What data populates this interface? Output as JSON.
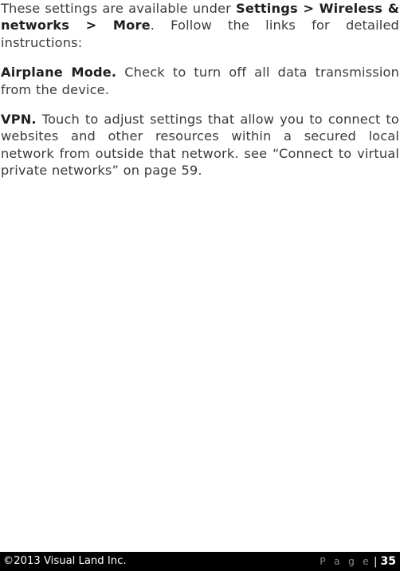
{
  "document": {
    "type": "user-manual-page",
    "background_color": "#ffffff",
    "text_color": "#3b3b3b",
    "bold_text_color": "#1f1f1f",
    "paragraphs": [
      {
        "id": "intro",
        "lead_bold": "",
        "segments": [
          {
            "text": "These settings are available under ",
            "bold": false
          },
          {
            "text": "Settings > Wireless & networks > More",
            "bold": true
          },
          {
            "text": ". Follow the links for detailed instructions:",
            "bold": false
          }
        ],
        "plain": "These settings are available under Settings > Wireless & networks > More. Follow the links for detailed instructions:"
      },
      {
        "id": "airplane-mode",
        "lead_bold": "Airplane Mode.",
        "segments": [
          {
            "text": "Airplane Mode.",
            "bold": true
          },
          {
            "text": " Check to turn off all data transmission from the device.",
            "bold": false
          }
        ],
        "plain": "Airplane Mode. Check to turn off all data transmission from the device."
      },
      {
        "id": "vpn",
        "lead_bold": "VPN.",
        "segments": [
          {
            "text": "VPN.",
            "bold": true
          },
          {
            "text": " Touch to adjust settings that allow you to connect to websites and other resources within a secured local network from outside that network. see “Connect to virtual private networks” on page 59.",
            "bold": false
          }
        ],
        "plain": "VPN. Touch to adjust settings that allow you to connect to websites and other resources within a secured local network from outside that network. see “Connect to virtual private networks” on page 59."
      }
    ],
    "body_parts": {
      "intro_before_bold": "These settings are available under ",
      "intro_bold": "Settings > Wireless & networks > More",
      "intro_after_bold": ". Follow the links for detailed instructions:",
      "airplane_bold": "Airplane Mode.",
      "airplane_rest": " Check to turn off all data transmission from the device.",
      "vpn_bold": "VPN.",
      "vpn_rest": " Touch to adjust settings that allow you to connect to websites and other resources within a secured local network from outside that network. see “Connect to virtual private networks” on page 59."
    },
    "cross_reference": {
      "title": "Connect to virtual private networks",
      "page": "59"
    }
  },
  "footer": {
    "background_color": "#000000",
    "copyright": "©2013 Visual Land Inc.",
    "page_label": "P a g e",
    "separator": "|",
    "page_number": "35",
    "page_label_color": "#8a8a8a",
    "page_number_color": "#ffffff"
  }
}
